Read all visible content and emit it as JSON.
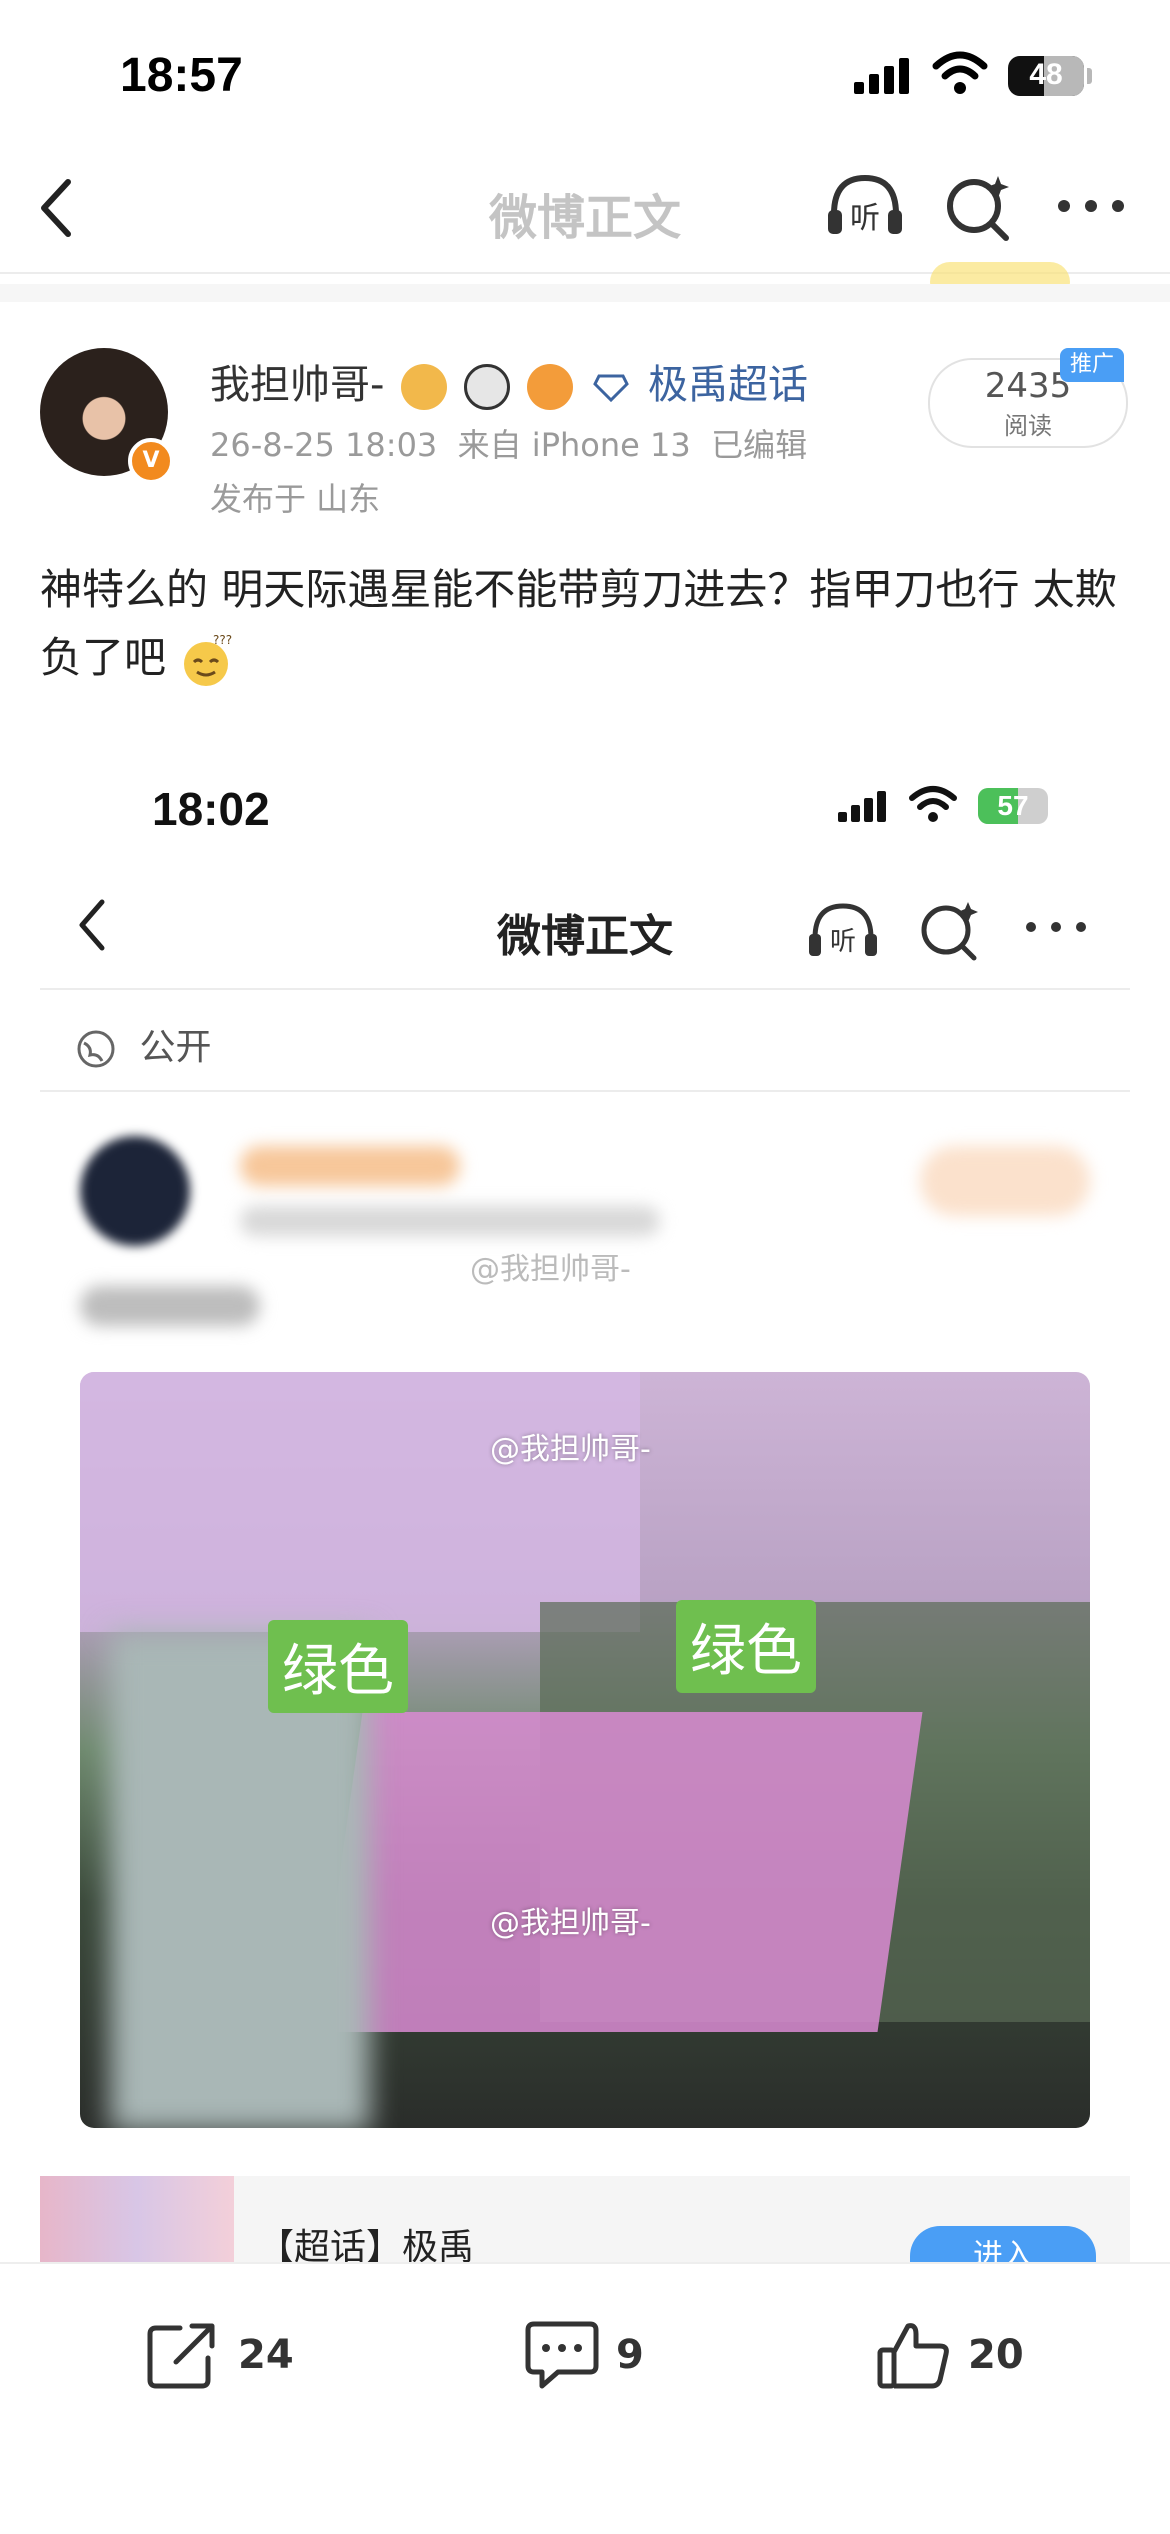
{
  "status_bar": {
    "time": "18:57",
    "battery_percent": "48",
    "battery_level": 0.48
  },
  "nav": {
    "title": "微博正文"
  },
  "post": {
    "author": {
      "name": "我担帅哥-",
      "verified_badge": "V",
      "super_topic": "极禹超话"
    },
    "meta": {
      "date": "26-8-25 18:03",
      "source": "来自 iPhone 13",
      "edited": "已编辑",
      "location": "发布于 山东"
    },
    "reads": {
      "count": "2435",
      "label": "阅读",
      "promo": "推广"
    },
    "text": "神特么的 明天际遇星能不能带剪刀进去？指甲刀也行 太欺负了吧"
  },
  "embedded_screenshot": {
    "time": "18:02",
    "battery_percent": "57",
    "battery_level": 0.57,
    "title": "微博正文",
    "visibility": "公开",
    "watermark": "@我担帅哥-",
    "photo_labels": [
      "绿色",
      "绿色"
    ]
  },
  "super_topic_card": {
    "label": "【超话】极禹",
    "button": "进入"
  },
  "actions": {
    "repost_count": "24",
    "comment_count": "9",
    "like_count": "20"
  }
}
